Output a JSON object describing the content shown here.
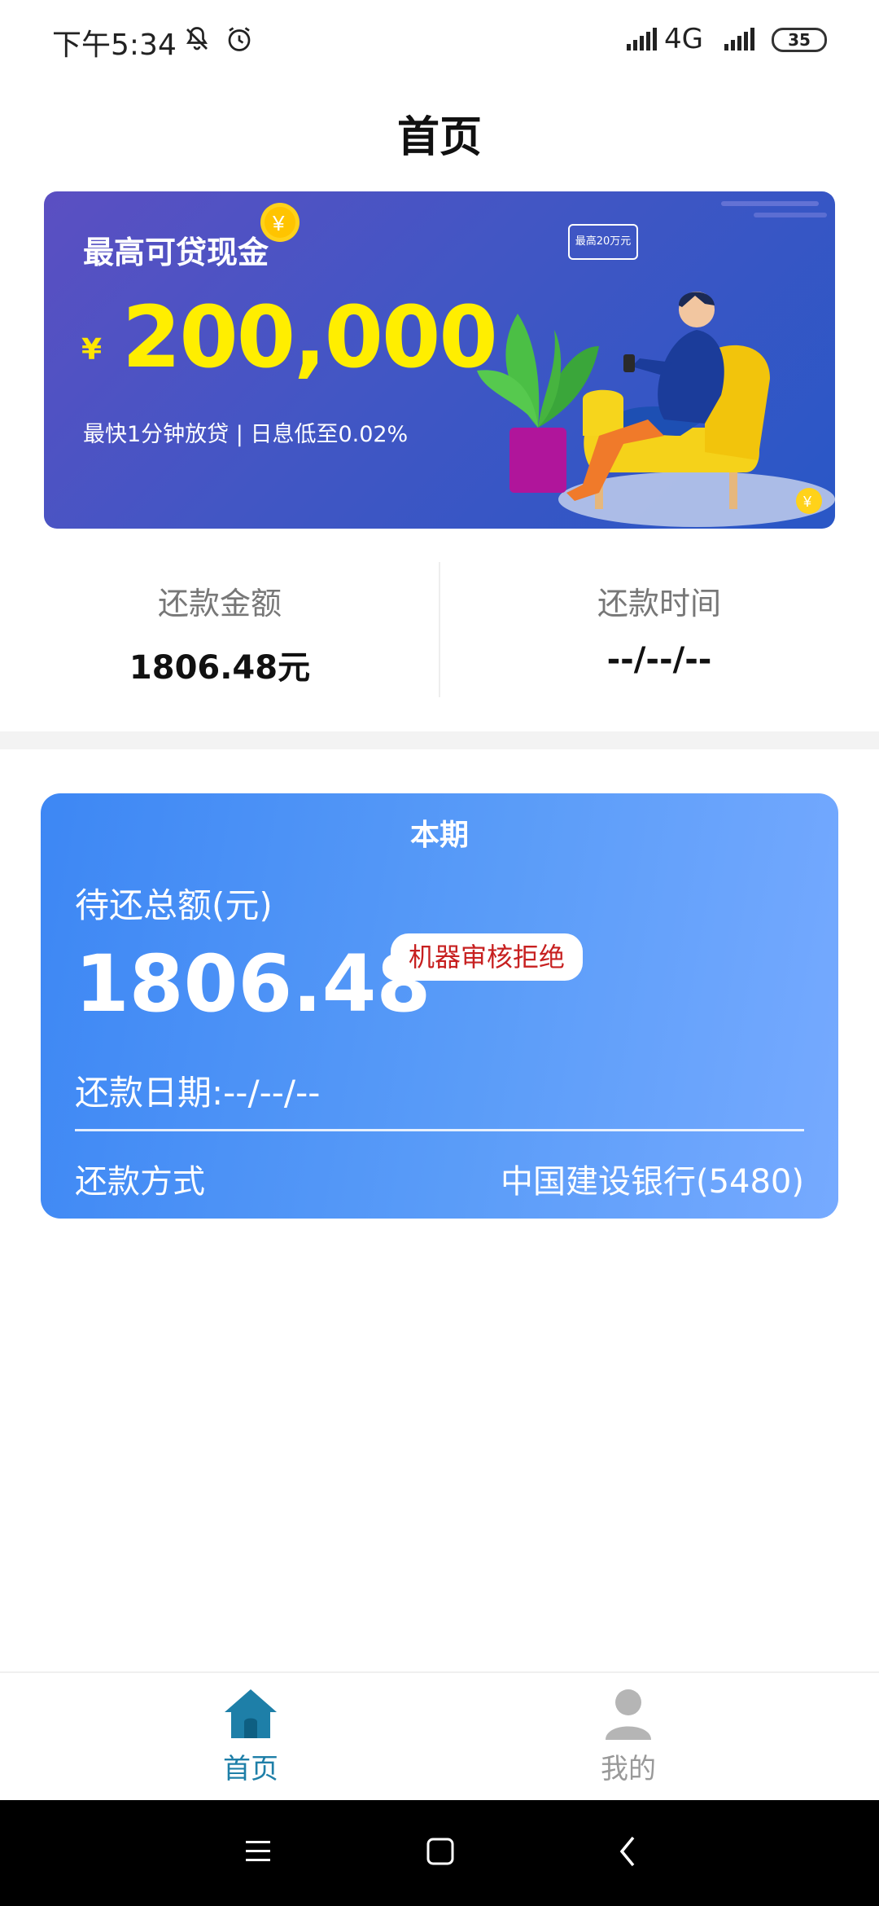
{
  "status_bar": {
    "time": "下午5:34",
    "network": "4G",
    "battery": "35"
  },
  "header": {
    "title": "首页"
  },
  "banner": {
    "heading": "最高可贷现金",
    "currency": "¥",
    "amount": "200,000",
    "subtitle": "最快1分钟放贷 | 日息低至0.02%",
    "bubble": "最高20万元"
  },
  "summary": {
    "repay_amount_label": "还款金额",
    "repay_amount_value": "1806.48元",
    "repay_time_label": "还款时间",
    "repay_time_value": "--/--/--"
  },
  "period_card": {
    "title": "本期",
    "total_label": "待还总额(元)",
    "total_value": "1806.48",
    "status_badge": "机器审核拒绝",
    "date_label": "还款日期:--/--/--",
    "method_label": "还款方式",
    "method_value": "中国建设银行(5480)"
  },
  "bottom_nav": {
    "items": [
      {
        "label": "首页",
        "icon": "home-icon",
        "active": true,
        "color": "#1e7fa8"
      },
      {
        "label": "我的",
        "icon": "user-icon",
        "active": false,
        "color": "#999999"
      }
    ]
  },
  "colors": {
    "banner_gradient_start": "#5b4fc2",
    "banner_gradient_end": "#2957c6",
    "card_gradient_start": "#3d87f4",
    "card_gradient_end": "#76aaff",
    "amount_yellow": "#ffee00",
    "badge_text_red": "#c72020"
  }
}
